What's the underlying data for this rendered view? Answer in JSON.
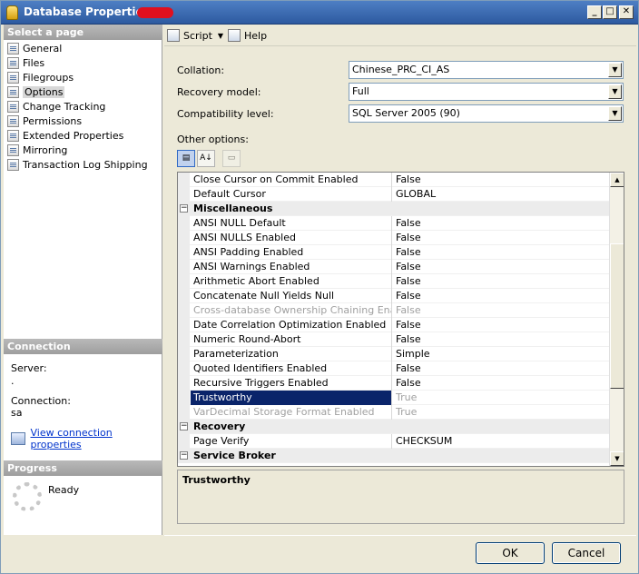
{
  "window": {
    "title": "Database Properties - "
  },
  "select_page": {
    "header": "Select a page",
    "items": [
      {
        "label": "General"
      },
      {
        "label": "Files"
      },
      {
        "label": "Filegroups"
      },
      {
        "label": "Options"
      },
      {
        "label": "Change Tracking"
      },
      {
        "label": "Permissions"
      },
      {
        "label": "Extended Properties"
      },
      {
        "label": "Mirroring"
      },
      {
        "label": "Transaction Log Shipping"
      }
    ],
    "selected": "Options"
  },
  "connection": {
    "header": "Connection",
    "server_label": "Server:",
    "server_value": ".",
    "connection_label": "Connection:",
    "connection_value": "sa",
    "view_link": "View connection properties"
  },
  "progress": {
    "header": "Progress",
    "status": "Ready"
  },
  "toolbar": {
    "script_label": "Script",
    "help_label": "Help"
  },
  "form": {
    "collation_label": "Collation:",
    "collation_value": "Chinese_PRC_CI_AS",
    "recovery_label": "Recovery model:",
    "recovery_value": "Full",
    "compat_label": "Compatibility level:",
    "compat_value": "SQL Server 2005 (90)",
    "other_options_label": "Other options:"
  },
  "grid": {
    "rows": [
      {
        "name": "Close Cursor on Commit Enabled",
        "value": "False"
      },
      {
        "name": "Default Cursor",
        "value": "GLOBAL"
      },
      {
        "name": "Miscellaneous",
        "category": true
      },
      {
        "name": "ANSI NULL Default",
        "value": "False"
      },
      {
        "name": "ANSI NULLS Enabled",
        "value": "False"
      },
      {
        "name": "ANSI Padding Enabled",
        "value": "False"
      },
      {
        "name": "ANSI Warnings Enabled",
        "value": "False"
      },
      {
        "name": "Arithmetic Abort Enabled",
        "value": "False"
      },
      {
        "name": "Concatenate Null Yields Null",
        "value": "False"
      },
      {
        "name": "Cross-database Ownership Chaining Enabled",
        "value": "False",
        "disabled": true
      },
      {
        "name": "Date Correlation Optimization Enabled",
        "value": "False"
      },
      {
        "name": "Numeric Round-Abort",
        "value": "False"
      },
      {
        "name": "Parameterization",
        "value": "Simple"
      },
      {
        "name": "Quoted Identifiers Enabled",
        "value": "False"
      },
      {
        "name": "Recursive Triggers Enabled",
        "value": "False"
      },
      {
        "name": "Trustworthy",
        "value": "True",
        "selected": true
      },
      {
        "name": "VarDecimal Storage Format Enabled",
        "value": "True",
        "disabled": true
      },
      {
        "name": "Recovery",
        "category": true
      },
      {
        "name": "Page Verify",
        "value": "CHECKSUM"
      },
      {
        "name": "Service Broker",
        "category": true
      }
    ]
  },
  "description": {
    "title": "Trustworthy"
  },
  "buttons": {
    "ok": "OK",
    "cancel": "Cancel"
  }
}
